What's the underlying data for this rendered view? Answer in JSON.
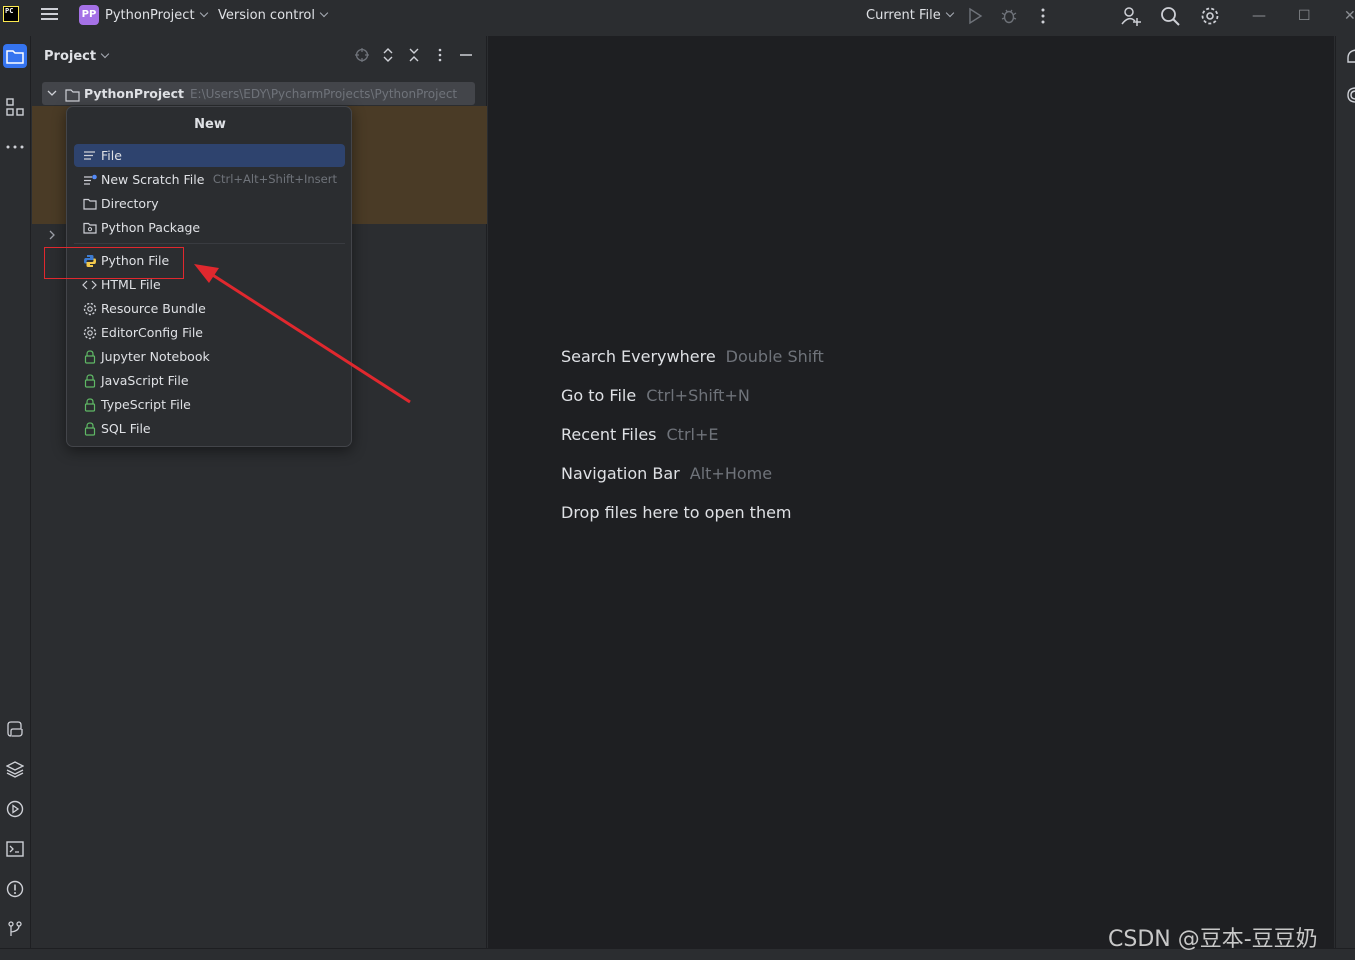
{
  "titlebar": {
    "logo_text": "PC",
    "project_badge": "PP",
    "project_name": "PythonProject",
    "vcs": "Version control",
    "run_config": "Current File"
  },
  "project_panel": {
    "title": "Project",
    "root": {
      "name": "PythonProject",
      "path": "E:\\Users\\EDY\\PycharmProjects\\PythonProject"
    }
  },
  "new_popup": {
    "title": "New",
    "items": [
      {
        "label": "File",
        "shortcut": "",
        "icon": "file-lines-icon",
        "selected": true
      },
      {
        "label": "New Scratch File",
        "shortcut": "Ctrl+Alt+Shift+Insert",
        "icon": "scratch-file-icon"
      },
      {
        "label": "Directory",
        "shortcut": "",
        "icon": "folder-icon"
      },
      {
        "label": "Python Package",
        "shortcut": "",
        "icon": "package-folder-icon"
      },
      {
        "label": "Python File",
        "shortcut": "",
        "icon": "python-icon"
      },
      {
        "label": "HTML File",
        "shortcut": "",
        "icon": "html-brackets-icon"
      },
      {
        "label": "Resource Bundle",
        "shortcut": "",
        "icon": "gear-icon"
      },
      {
        "label": "EditorConfig File",
        "shortcut": "",
        "icon": "gear-icon"
      },
      {
        "label": "Jupyter Notebook",
        "shortcut": "",
        "icon": "lock-icon"
      },
      {
        "label": "JavaScript File",
        "shortcut": "",
        "icon": "lock-icon"
      },
      {
        "label": "TypeScript File",
        "shortcut": "",
        "icon": "lock-icon"
      },
      {
        "label": "SQL File",
        "shortcut": "",
        "icon": "lock-icon"
      }
    ]
  },
  "editor_hints": [
    {
      "action": "Search Everywhere",
      "key": "Double Shift"
    },
    {
      "action": "Go to File",
      "key": "Ctrl+Shift+N"
    },
    {
      "action": "Recent Files",
      "key": "Ctrl+E"
    },
    {
      "action": "Navigation Bar",
      "key": "Alt+Home"
    },
    {
      "action": "Drop files here to open them",
      "key": ""
    }
  ],
  "watermark": "CSDN @豆本-豆豆奶",
  "colors": {
    "selection": "#2e436e",
    "accent": "#3574f0",
    "annotation_red": "#e0282e",
    "highlight_row": "#4a3b26",
    "lock_green": "#5fb865"
  }
}
